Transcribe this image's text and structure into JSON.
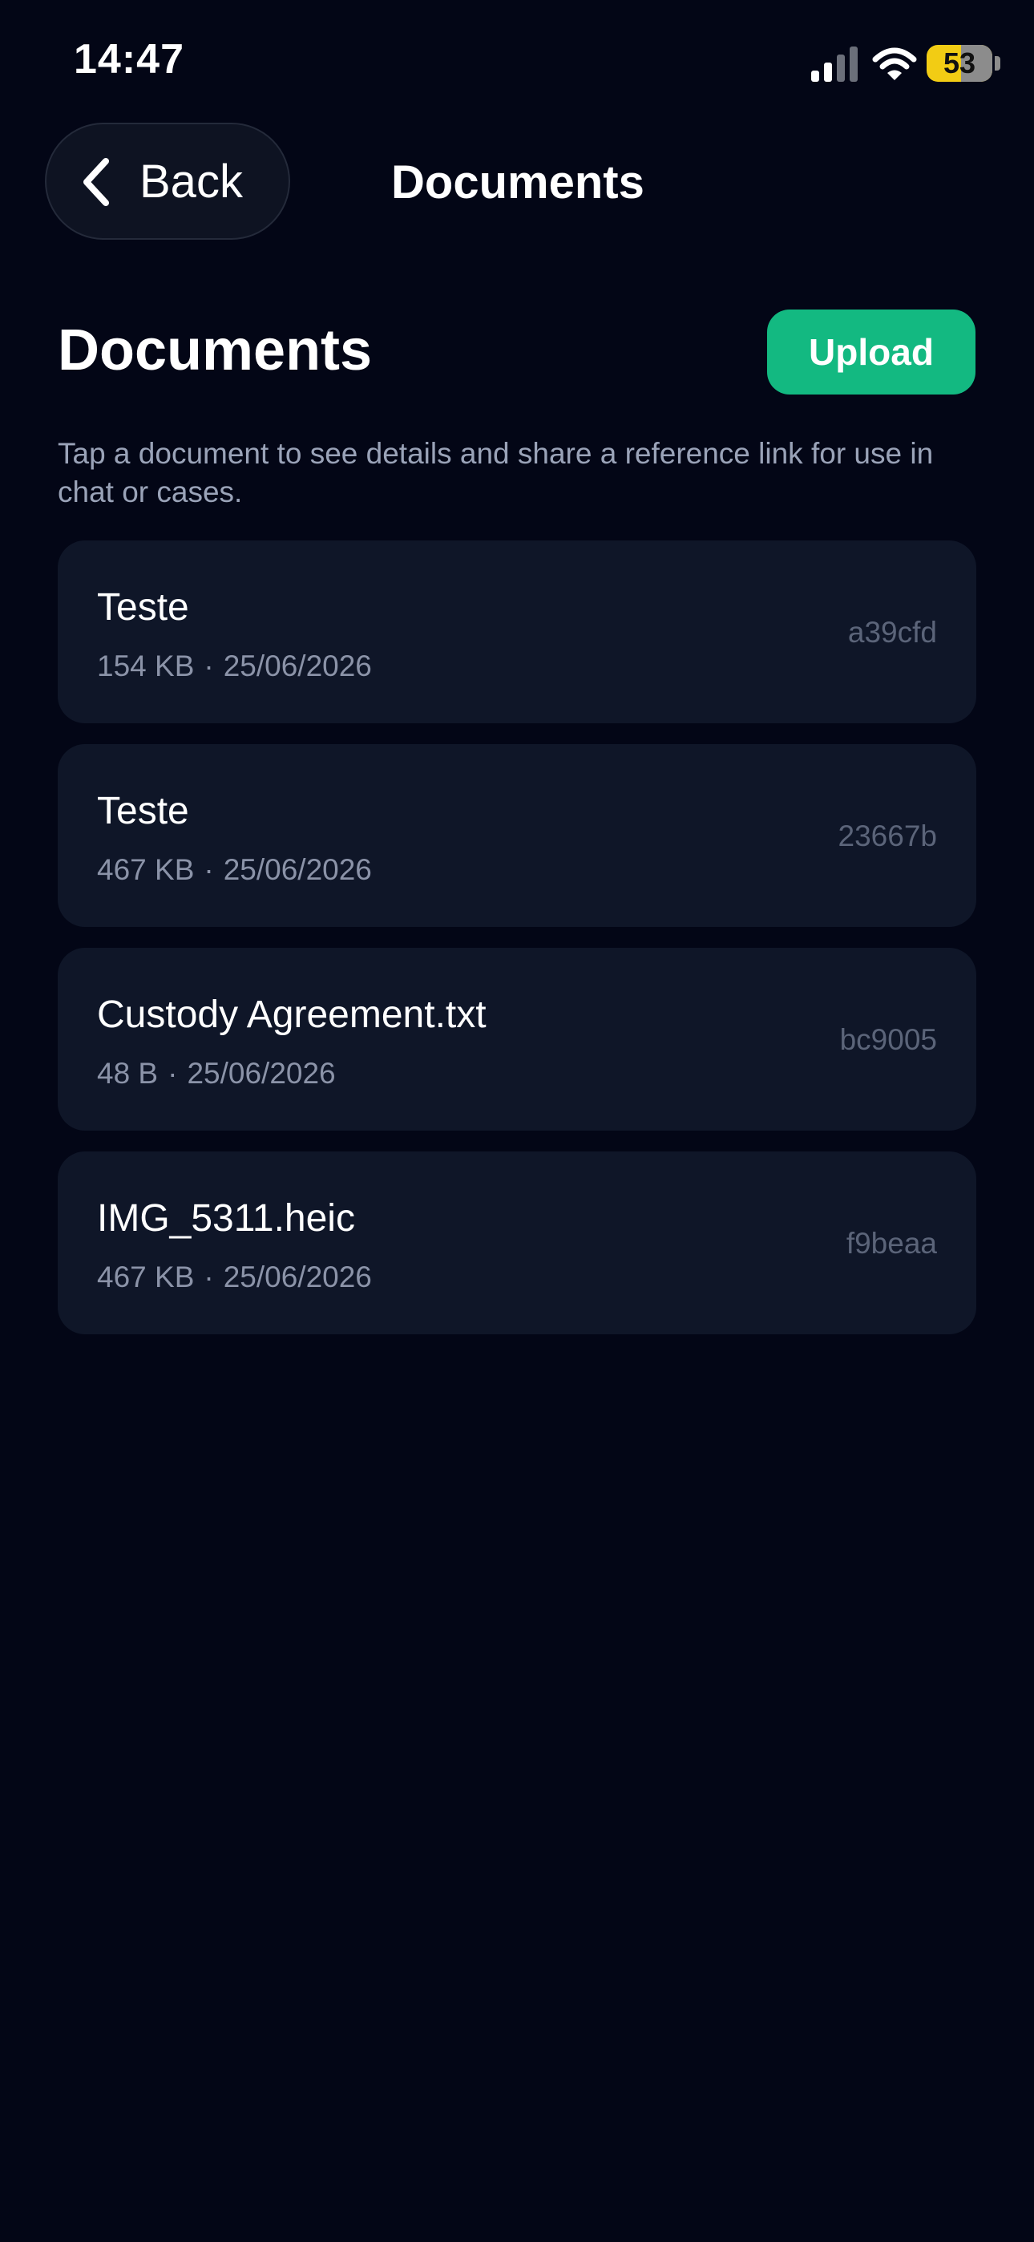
{
  "status_bar": {
    "time": "14:47",
    "battery_level": "53",
    "battery_fraction": 0.53
  },
  "nav": {
    "back_label": "Back",
    "title": "Documents"
  },
  "header": {
    "title": "Documents",
    "upload_label": "Upload",
    "description": "Tap a document to see details and share a reference link for use in chat or cases."
  },
  "documents": [
    {
      "name": "Teste",
      "size": "154 KB",
      "separator": "·",
      "date": "25/06/2026",
      "id": "a39cfd"
    },
    {
      "name": "Teste",
      "size": "467 KB",
      "separator": "·",
      "date": "25/06/2026",
      "id": "23667b"
    },
    {
      "name": "Custody Agreement.txt",
      "size": "48 B",
      "separator": "·",
      "date": "25/06/2026",
      "id": "bc9005"
    },
    {
      "name": "IMG_5311.heic",
      "size": "467 KB",
      "separator": "·",
      "date": "25/06/2026",
      "id": "f9beaa"
    }
  ],
  "colors": {
    "background": "#030616",
    "card": "#0f1628",
    "accent": "#13b981",
    "battery": "#f2cc14"
  },
  "icons": {
    "back": "chevron-left-icon",
    "signal": "cellular-signal-icon",
    "wifi": "wifi-icon",
    "battery": "battery-icon"
  }
}
